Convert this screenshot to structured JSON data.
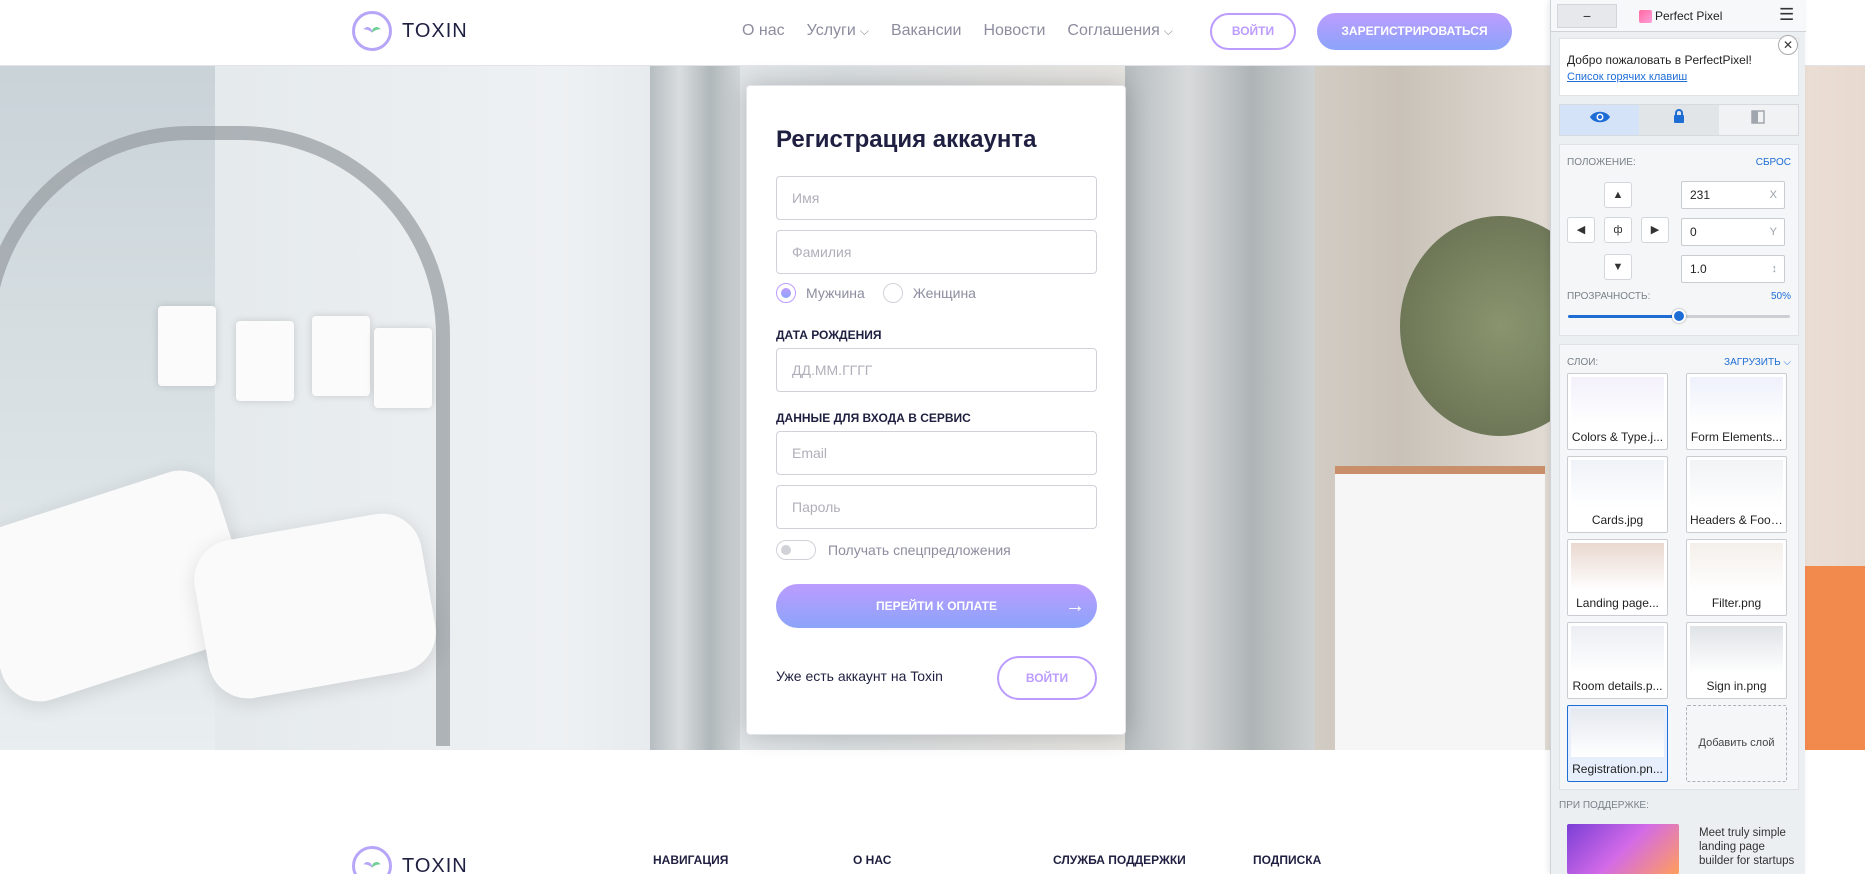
{
  "header": {
    "logo_text": "TOXIN",
    "nav": [
      {
        "label": "О нас",
        "has_caret": false
      },
      {
        "label": "Услуги",
        "has_caret": true
      },
      {
        "label": "Вакансии",
        "has_caret": false
      },
      {
        "label": "Новости",
        "has_caret": false
      },
      {
        "label": "Соглашения",
        "has_caret": true
      }
    ],
    "login_label": "ВОЙТИ",
    "register_label": "ЗАРЕГИСТРИРОВАТЬСЯ"
  },
  "form": {
    "title": "Регистрация аккаунта",
    "first_name_placeholder": "Имя",
    "last_name_placeholder": "Фамилия",
    "gender_male": "Мужчина",
    "gender_female": "Женщина",
    "gender_selected": "male",
    "dob_label": "ДАТА РОЖДЕНИЯ",
    "dob_placeholder": "ДД.ММ.ГГГГ",
    "login_section_label": "ДАННЫЕ ДЛЯ ВХОДА В СЕРВИС",
    "email_placeholder": "Email",
    "password_placeholder": "Пароль",
    "offers_toggle_label": "Получать спецпредложения",
    "offers_toggle_on": false,
    "submit_label": "ПЕРЕЙТИ К ОПЛАТЕ",
    "submit_arrow": "→",
    "have_account_text": "Уже есть аккаунт на Toxin",
    "login_label": "ВОЙТИ"
  },
  "footer": {
    "logo_text": "TOXIN",
    "columns": [
      "НАВИГАЦИЯ",
      "О НАС",
      "СЛУЖБА ПОДДЕРЖКИ",
      "ПОДПИСКА"
    ]
  },
  "perfectpixel": {
    "minimize_label": "−",
    "title": "Perfect Pixel",
    "menu_icon": "☰",
    "welcome_text": "Добро пожаловать в PerfectPixel!",
    "hotkeys_link": "Список горячих клавиш",
    "close_icon": "✕",
    "tabs": [
      {
        "icon": "eye-icon",
        "glyph": "👁"
      },
      {
        "icon": "lock-icon",
        "glyph": "🔒"
      },
      {
        "icon": "invert-icon",
        "glyph": "◧"
      }
    ],
    "position_label": "ПОЛОЖЕНИЕ:",
    "reset_label": "СБРОС",
    "x_value": "231",
    "x_suffix": "X",
    "y_value": "0",
    "y_suffix": "Y",
    "scale_value": "1.0",
    "scale_suffix": "↕",
    "center_glyph": "ф",
    "opacity_label": "ПРОЗРАЧНОСТЬ:",
    "opacity_value": "50%",
    "opacity_fraction": 0.5,
    "layers_label": "СЛОИ:",
    "upload_label": "ЗАГРУЗИТЬ",
    "layers": [
      {
        "name": "Colors & Type.j...",
        "selected": false
      },
      {
        "name": "Form Elements...",
        "selected": false
      },
      {
        "name": "Cards.jpg",
        "selected": false
      },
      {
        "name": "Headers & Foot...",
        "selected": false
      },
      {
        "name": "Landing page...",
        "selected": false
      },
      {
        "name": "Filter.png",
        "selected": false
      },
      {
        "name": "Room details.p...",
        "selected": false
      },
      {
        "name": "Sign in.png",
        "selected": false
      },
      {
        "name": "Registration.pn...",
        "selected": true
      }
    ],
    "add_layer_label": "Добавить слой",
    "support_label": "ПРИ ПОДДЕРЖКЕ:",
    "ad_text": "Meet truly simple landing page builder for startups"
  }
}
